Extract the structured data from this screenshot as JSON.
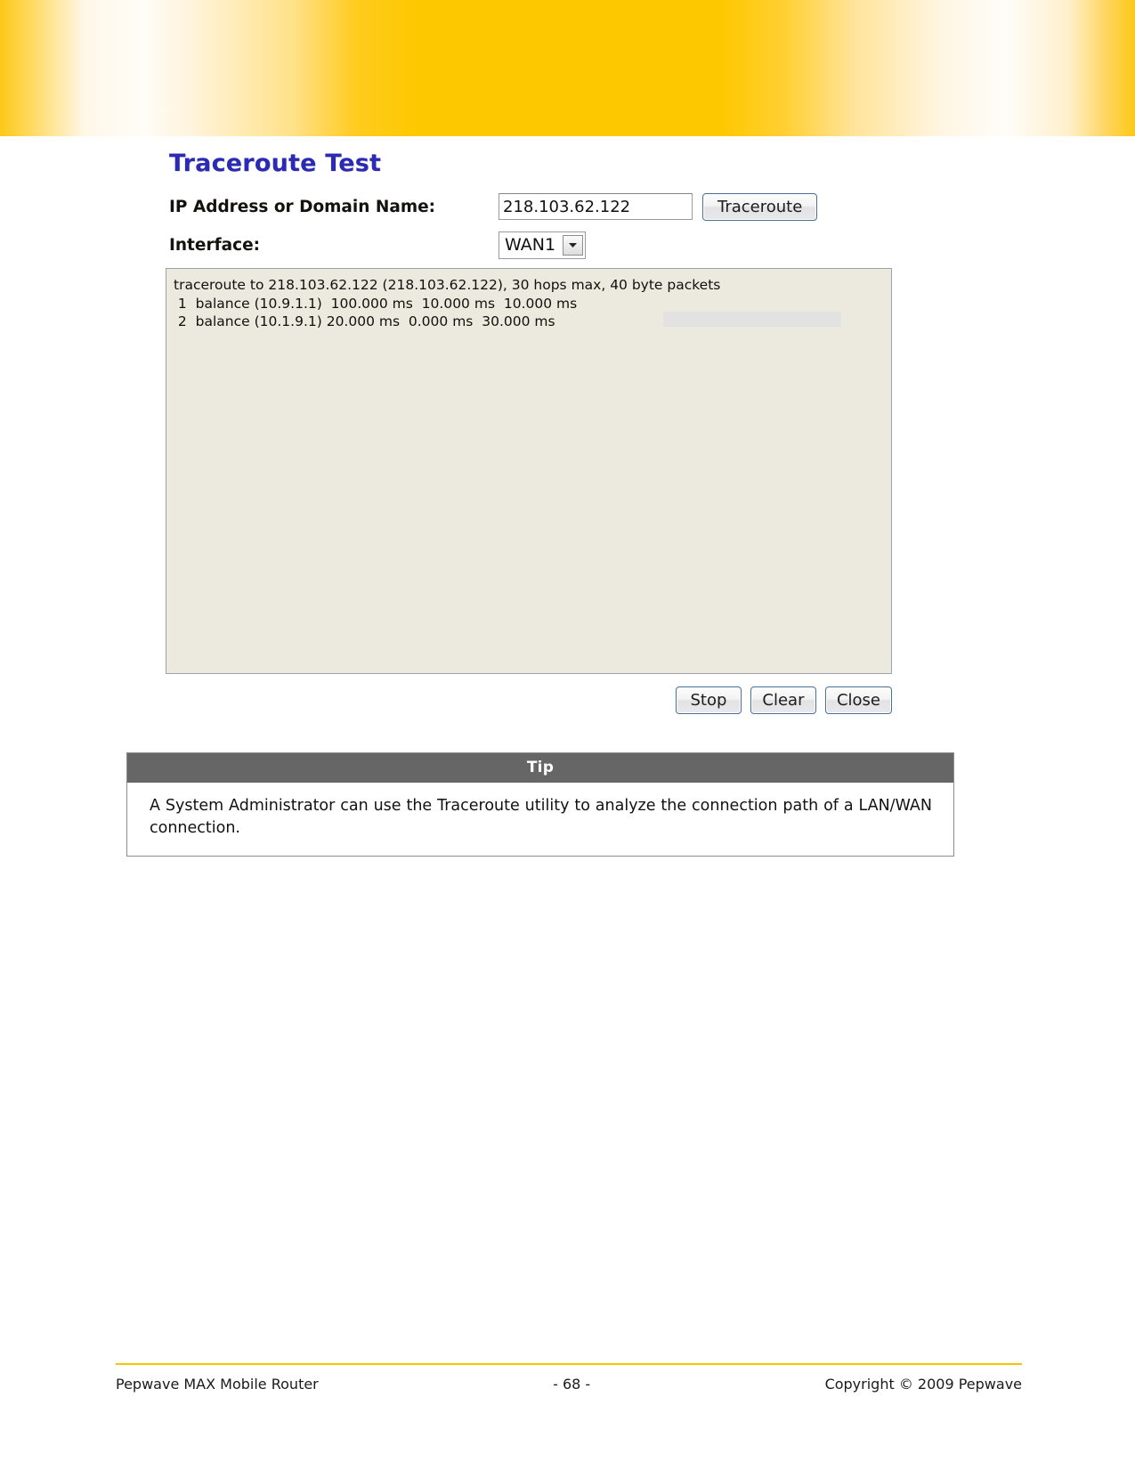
{
  "banner": {
    "accent_color": "#fec800",
    "highlight_color": "#fffdf8"
  },
  "panel": {
    "title": "Traceroute Test",
    "fields": {
      "host_label": "IP Address or Domain Name:",
      "host_value": "218.103.62.122",
      "host_placeholder": "",
      "interface_label": "Interface:",
      "interface_value": "WAN1",
      "interface_options": [
        "WAN1"
      ]
    },
    "run_button": "Traceroute",
    "console_lines": [
      "traceroute to 218.103.62.122 (218.103.62.122), 30 hops max, 40 byte packets",
      " 1  balance (10.9.1.1)  100.000 ms  10.000 ms  10.000 ms",
      " 2  balance (10.1.9.1) 20.000 ms  0.000 ms  30.000 ms"
    ],
    "console_bg": "#eceade",
    "actions": [
      {
        "label": "Stop",
        "name": "stop-button"
      },
      {
        "label": "Clear",
        "name": "clear-button"
      },
      {
        "label": "Close",
        "name": "close-button"
      }
    ]
  },
  "tip": {
    "header": "Tip",
    "body": "A System Administrator can use the Traceroute utility to analyze the connection path of a LAN/WAN connection."
  },
  "footer": {
    "left": "Pepwave MAX Mobile Router",
    "center": "- 68 -",
    "right": "Copyright © 2009 Pepwave",
    "rule_color": "#f5c400"
  }
}
